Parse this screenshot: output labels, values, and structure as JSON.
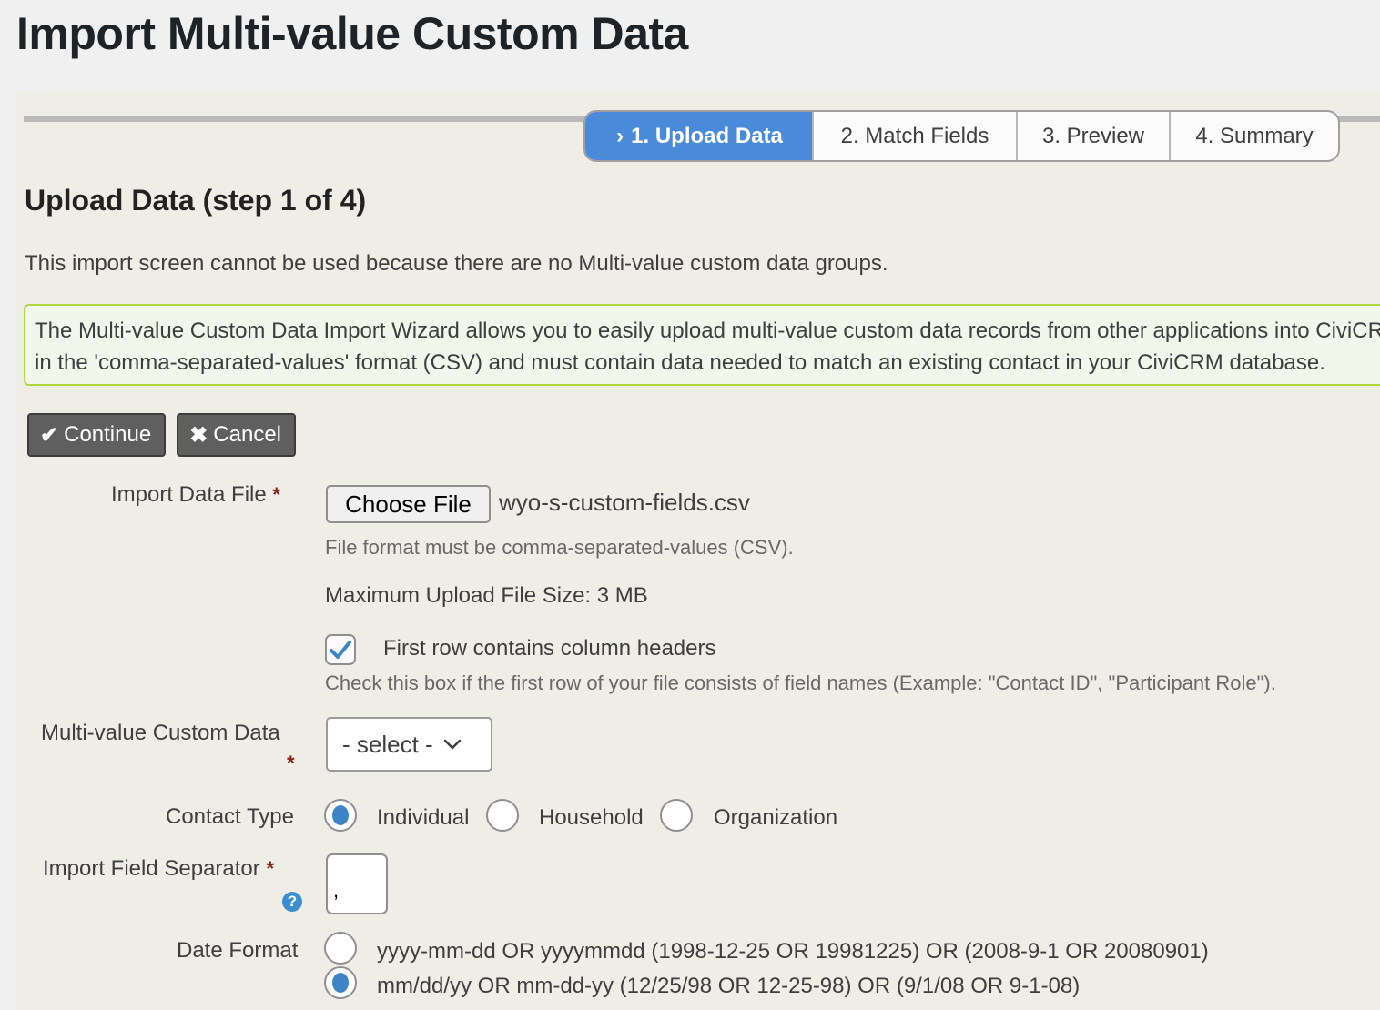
{
  "page": {
    "title": "Import Multi-value Custom Data"
  },
  "wizard": {
    "steps": [
      {
        "label": "1. Upload Data",
        "active": true,
        "icon": "chevron-right-icon"
      },
      {
        "label": "2. Match Fields",
        "active": false
      },
      {
        "label": "3. Preview",
        "active": false
      },
      {
        "label": "4. Summary",
        "active": false
      }
    ],
    "active_chevron": "›"
  },
  "section": {
    "title": "Upload Data (step 1 of 4)",
    "status_message": "This import screen cannot be used because there are no Multi-value custom data groups.",
    "help_line1": "The Multi-value Custom Data Import Wizard allows you to easily upload multi-value custom data records from other applications into CiviCRM. Files to be imported must be",
    "help_line2": "in the 'comma-separated-values' format (CSV) and must contain data needed to match an existing contact in your CiviCRM database."
  },
  "buttons": {
    "continue_label": "Continue",
    "continue_icon": "✔",
    "cancel_label": "Cancel",
    "cancel_icon": "✖"
  },
  "form": {
    "required_marker": "*",
    "import_file": {
      "label": "Import Data File",
      "button_label": "Choose File",
      "file_name": "wyo-s-custom-fields.csv",
      "description": "File format must be comma-separated-values (CSV).",
      "max_size": "Maximum Upload File Size: 3 MB"
    },
    "headers_checkbox": {
      "label": "First row contains column headers",
      "checked": true,
      "description": "Check this box if the first row of your file consists of field names (Example: \"Contact ID\", \"Participant Role\")."
    },
    "multi_value": {
      "label": "Multi-value Custom Data",
      "selected": "- select -"
    },
    "contact_type": {
      "label": "Contact Type",
      "options": [
        "Individual",
        "Household",
        "Organization"
      ],
      "selected": "Individual"
    },
    "field_separator": {
      "label": "Import Field Separator",
      "value": ",",
      "help_icon": "?"
    },
    "date_format": {
      "label": "Date Format",
      "options": [
        "yyyy-mm-dd OR yyyymmdd (1998-12-25 OR 19981225) OR (2008-9-1 OR 20080901)",
        "mm/dd/yy OR mm-dd-yy (12/25/98 OR 12-25-98) OR (9/1/08 OR 9-1-08)"
      ],
      "selected_index": 1
    }
  },
  "colors": {
    "accent": "#4a8bd9",
    "help_border": "#b0d73f",
    "required": "#8a1f11",
    "button_bg": "#5f5f5f"
  }
}
